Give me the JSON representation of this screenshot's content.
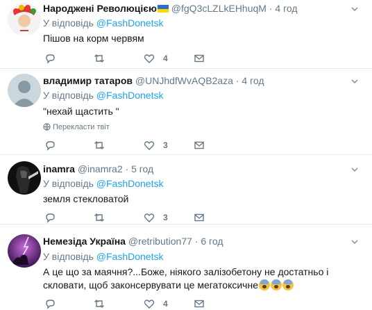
{
  "tweets": [
    {
      "name": "Народжені Революцією",
      "handle": "@fgQ3cLZLkEHhuqM",
      "dot": "·",
      "time": "4 год",
      "reply_prefix": "У відповідь",
      "reply_mention": "@FashDonetsk",
      "text": "Пішов на корм червям",
      "like_count": "4"
    },
    {
      "name": "владимир татаров",
      "handle": "@UNJhdfWvAQB2aza",
      "dot": "·",
      "time": "4 год",
      "reply_prefix": "У відповідь",
      "reply_mention": "@FashDonetsk",
      "text": "\"нехай щастить \"",
      "translate": "Перекласти твіт",
      "like_count": "3"
    },
    {
      "name": "inamra",
      "handle": "@inamra2",
      "dot": "·",
      "time": "5 год",
      "reply_prefix": "У відповідь",
      "reply_mention": "@FashDonetsk",
      "text": "земля стекловатой",
      "like_count": "3"
    },
    {
      "name": "Немезіда Україна",
      "handle": "@retribution77",
      "dot": "·",
      "time": "6 год",
      "reply_prefix": "У відповідь",
      "reply_mention": "@FashDonetsk",
      "text": "А це що за маячня?...Боже, ніякого залізобетону не достатньо і скловати, щоб законсервувати це мегатоксичне",
      "like_count": "4"
    }
  ],
  "icons": {
    "reply": "reply-icon",
    "retweet": "retweet-icon",
    "like": "heart-icon",
    "dm": "envelope-icon",
    "caret": "chevron-down-icon",
    "globe": "globe-icon"
  },
  "colors": {
    "link": "#1da1f2",
    "muted": "#657786",
    "divider": "#e6ecf0"
  }
}
